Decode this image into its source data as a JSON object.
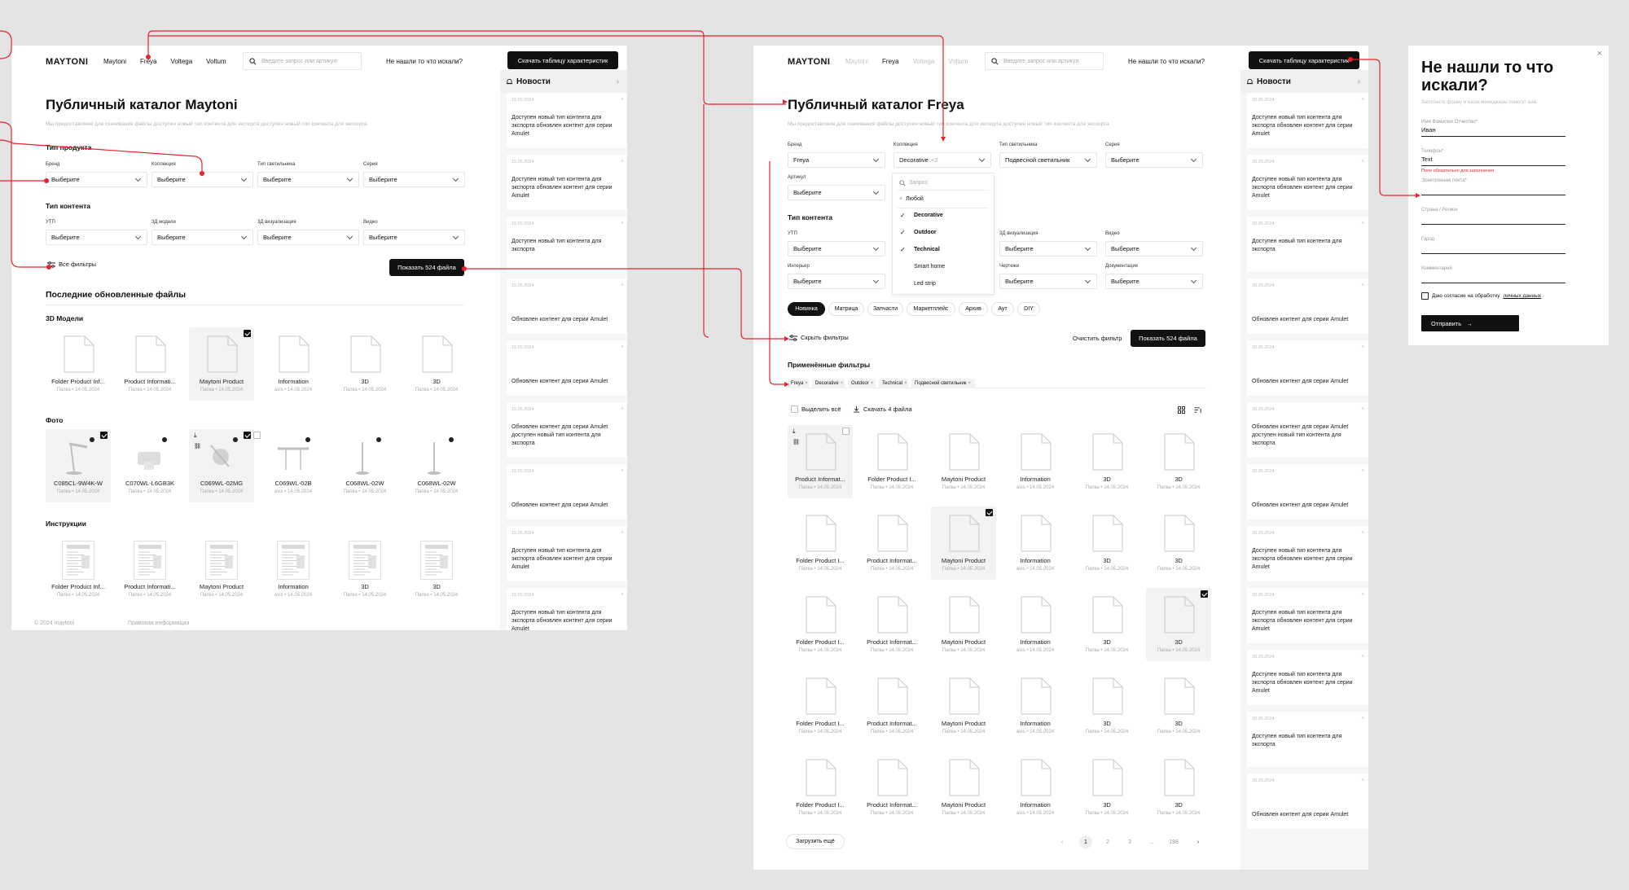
{
  "screen1": {
    "brand": "MAYTONI",
    "nav": [
      "Maytoni",
      "Freya",
      "Voltega",
      "Voltum"
    ],
    "search_placeholder": "Введите запрос или артикул",
    "not_found": "Не нашли то что искали?",
    "download_table": "Скачать таблицу характеристик",
    "title": "Публичный каталог Maytoni",
    "subtitle": "Мы предоставляем для скачивания файлы доступен новый тип контента для экспорта доступен новый тип контента для экспорта",
    "product_type": "Тип продукта",
    "filters_row1": [
      {
        "label": "Бренд",
        "value": "Выберите"
      },
      {
        "label": "Коллекция",
        "value": "Выберите"
      },
      {
        "label": "Тип светильника",
        "value": "Выберите"
      },
      {
        "label": "Серия",
        "value": "Выберите"
      }
    ],
    "content_type": "Тип контента",
    "filters_row2": [
      {
        "label": "УТП",
        "value": "Выберите"
      },
      {
        "label": "3Д модели",
        "value": "Выберите"
      },
      {
        "label": "3Д визуализация",
        "value": "Выберите"
      },
      {
        "label": "Видео",
        "value": "Выберите"
      }
    ],
    "all_filters": "Все фильтры",
    "show_files": "Показать 524 файла",
    "recent": "Последние обновленные файлы",
    "groups": [
      {
        "title": "3D Модели",
        "items": [
          {
            "name": "Folder Product Inf...",
            "meta": "Папка • 14.05.2024"
          },
          {
            "name": "Product Informati...",
            "meta": "Папка • 14.05.2024"
          },
          {
            "name": "Maytoni Product",
            "meta": "Папка • 14.05.2024",
            "selected": true
          },
          {
            "name": "Information",
            "meta": "avis • 14.05.2024"
          },
          {
            "name": "3D",
            "meta": "Папка • 14.05.2024"
          },
          {
            "name": "3D",
            "meta": "Папка • 14.05.2024"
          }
        ]
      },
      {
        "title": "Фото",
        "items": [
          {
            "name": "C085CL-9W4K-W",
            "meta": "Папка • 14.05.2024",
            "selected": true
          },
          {
            "name": "C070WL-L6GB3K",
            "meta": "Папка • 14.05.2024"
          },
          {
            "name": "C069WL-02MG",
            "meta": "Папка • 14.05.2024",
            "selected": true
          },
          {
            "name": "C069WL-02B",
            "meta": "avis • 14.05.2024"
          },
          {
            "name": "C068WL-02W",
            "meta": "Папка • 14.05.2024"
          },
          {
            "name": "C068WL-02W",
            "meta": "Папка • 14.05.2024"
          }
        ]
      },
      {
        "title": "Инструкции",
        "items": [
          {
            "name": "Folder Product Inf...",
            "meta": "Папка • 14.05.2024"
          },
          {
            "name": "Product Informati...",
            "meta": "Папка • 14.05.2024"
          },
          {
            "name": "Maytoni Product",
            "meta": "Папка • 14.05.2024"
          },
          {
            "name": "Information",
            "meta": "avis • 14.05.2024"
          },
          {
            "name": "3D",
            "meta": "Папка • 14.05.2024"
          },
          {
            "name": "3D",
            "meta": "Папка • 14.05.2024"
          }
        ]
      }
    ],
    "footer_copy": "© 2024 maytoni",
    "footer_legal": "Правовая информация"
  },
  "news": {
    "title": "Новости",
    "items": [
      {
        "date": "15.05.2024",
        "text": "Доступен новый тип контента для экспорта обновлен контент для серии Amulet"
      },
      {
        "date": "15.05.2024",
        "text": "Доступен новый тип контента для экспорта обновлен контент для серии Amulet"
      },
      {
        "date": "15.05.2024",
        "text": "Доступен новый тип контента для экспорта"
      },
      {
        "date": "15.05.2024",
        "text": "Обновлен контент для серии Amulet"
      },
      {
        "date": "15.05.2024",
        "text": "Обновлен контент для серии Amulet"
      },
      {
        "date": "15.05.2024",
        "text": "Обновлен контент для серии Amulet доступен новый тип контента для экспорта"
      },
      {
        "date": "15.05.2024",
        "text": "Обновлен контент для серии Amulet"
      },
      {
        "date": "15.05.2024",
        "text": "Доступен новый тип контента для экспорта обновлен контент для серии Amulet"
      }
    ]
  },
  "screen2": {
    "brand": "MAYTONI",
    "nav": [
      "Maytoni",
      "Freya",
      "Voltega",
      "Voltum"
    ],
    "search_placeholder": "Введите запрос или артикул",
    "not_found": "Не нашли то что искали?",
    "download_table": "Скачать таблицу характеристик",
    "title": "Публичный каталог Freya",
    "subtitle": "Мы предоставляем для скачивания файлы доступен новый тип контента для экспорта доступен новый тип контента для экспорта",
    "filters_row1": [
      {
        "label": "Бренд",
        "value": "Freya"
      },
      {
        "label": "Коллекция",
        "value": "Decorative",
        "count": "+2"
      },
      {
        "label": "Тип светильника",
        "value": "Подвесной светильник"
      },
      {
        "label": "Серия",
        "value": "Выберите"
      }
    ],
    "article": {
      "label": "Артикул",
      "value": "Выберите"
    },
    "dropdown": {
      "search": "Запрос",
      "any": "Любой",
      "options": [
        {
          "label": "Decorative",
          "checked": true
        },
        {
          "label": "Outdoor",
          "checked": true
        },
        {
          "label": "Technical",
          "checked": true
        },
        {
          "label": "Smart home",
          "checked": false
        },
        {
          "label": "Led strip",
          "checked": false
        }
      ]
    },
    "content_type": "Тип контента",
    "filters_row2": [
      {
        "label": "УТП",
        "value": "Выберите"
      },
      {
        "label": "3Д визуализация",
        "value": "Выберите"
      },
      {
        "label": "Видео",
        "value": "Выберите"
      }
    ],
    "filters_row3": [
      {
        "label": "Интерьер",
        "value": "Выберите"
      },
      {
        "label": "Чертежи",
        "value": "Выберите"
      },
      {
        "label": "Документация",
        "value": "Выберите"
      }
    ],
    "chips": [
      "Новинка",
      "Матрица",
      "Запчасти",
      "Маркетплейс",
      "Архив",
      "Аут",
      "DIY"
    ],
    "hide_filters": "Скрыть фильтры",
    "clear_filters": "Очистить фильтр",
    "show_files": "Показать 524 файла",
    "applied": "Применённые фильтры",
    "tags": [
      "Freya",
      "Decorative",
      "Outdoor",
      "Technical",
      "Подвесной светильник"
    ],
    "select_all": "Выделить всё",
    "download_n": "Скачать 4 файла",
    "grid": [
      [
        {
          "name": "Product Informat...",
          "meta": "Папка • 14.05.2024",
          "hover": true
        },
        {
          "name": "Folder Product I...",
          "meta": "Папка • 14.05.2024"
        },
        {
          "name": "Maytoni Product",
          "meta": "Папка • 14.05.2024"
        },
        {
          "name": "Information",
          "meta": "avis • 14.05.2024"
        },
        {
          "name": "3D",
          "meta": "Папка • 14.05.2024"
        },
        {
          "name": "3D",
          "meta": "Папка • 14.05.2024"
        }
      ],
      [
        {
          "name": "Folder Product I...",
          "meta": "Папка • 14.05.2024"
        },
        {
          "name": "Product Informat...",
          "meta": "Папка • 14.05.2024"
        },
        {
          "name": "Maytoni Product",
          "meta": "Папка • 14.05.2024",
          "selected": true
        },
        {
          "name": "Information",
          "meta": "avis • 14.05.2024"
        },
        {
          "name": "3D",
          "meta": "Папка • 14.05.2024"
        },
        {
          "name": "3D",
          "meta": "Папка • 14.05.2024"
        }
      ],
      [
        {
          "name": "Folder Product I...",
          "meta": "Папка • 14.05.2024"
        },
        {
          "name": "Product Informat...",
          "meta": "Папка • 14.05.2024"
        },
        {
          "name": "Maytoni Product",
          "meta": "Папка • 14.05.2024"
        },
        {
          "name": "Information",
          "meta": "avis • 14.05.2024"
        },
        {
          "name": "3D",
          "meta": "Папка • 14.05.2024"
        },
        {
          "name": "3D",
          "meta": "Папка • 14.05.2024",
          "selected": true
        }
      ],
      [
        {
          "name": "Folder Product I...",
          "meta": "Папка • 14.05.2024"
        },
        {
          "name": "Product Informat...",
          "meta": "Папка • 14.05.2024"
        },
        {
          "name": "Maytoni Product",
          "meta": "Папка • 14.05.2024"
        },
        {
          "name": "Information",
          "meta": "avis • 14.05.2024"
        },
        {
          "name": "3D",
          "meta": "Папка • 14.05.2024"
        },
        {
          "name": "3D",
          "meta": "Папка • 14.05.2024"
        }
      ],
      [
        {
          "name": "Folder Product I...",
          "meta": "Папка • 14.05.2024"
        },
        {
          "name": "Product Informat...",
          "meta": "Папка • 14.05.2024"
        },
        {
          "name": "Maytoni Product",
          "meta": "Папка • 14.05.2024"
        },
        {
          "name": "Information",
          "meta": "avis • 14.05.2024"
        },
        {
          "name": "3D",
          "meta": "Папка • 14.05.2024"
        },
        {
          "name": "3D",
          "meta": "Папка • 14.05.2024"
        }
      ]
    ],
    "load_more": "Загрузить ещё",
    "pages": [
      "1",
      "2",
      "3",
      "...",
      "198"
    ]
  },
  "form": {
    "title": "Не нашли то что искали?",
    "subtitle": "Заполните форму и наши менеджеры помогут вам",
    "fields": [
      {
        "label": "Имя Фамилия Отчество*",
        "value": "Иван"
      },
      {
        "label": "Телефон*",
        "value": "Text",
        "error": "Поле обязательно для заполнения"
      },
      {
        "label": "Электронная почта*",
        "value": ""
      },
      {
        "label": "Страна / Регион",
        "value": ""
      },
      {
        "label": "Город",
        "value": ""
      },
      {
        "label": "Комментарий",
        "value": ""
      }
    ],
    "consent": "Даю согласие на обработку",
    "consent_link": "личных данных",
    "submit": "Отправить"
  },
  "colors": {
    "accent": "#e8232b",
    "dark": "#111111"
  }
}
